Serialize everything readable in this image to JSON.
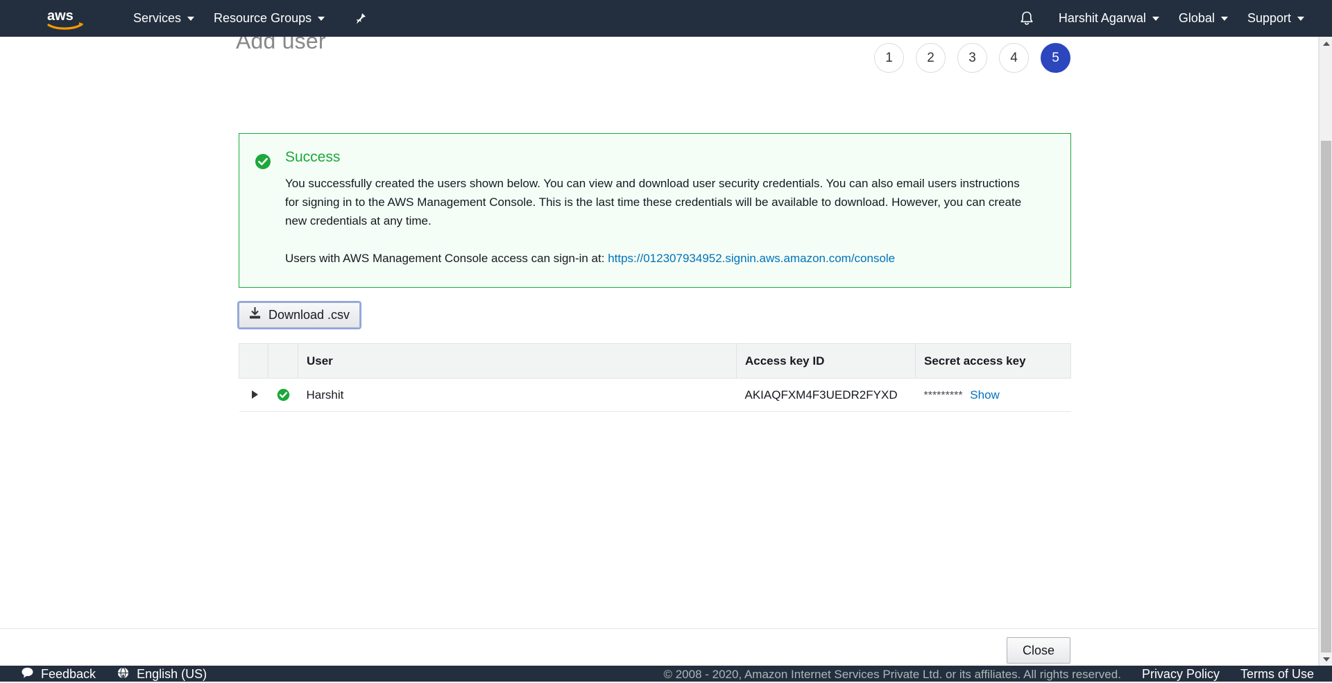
{
  "topnav": {
    "logo_alt": "aws",
    "services_label": "Services",
    "resource_groups_label": "Resource Groups",
    "pin_icon": "pin-icon",
    "bell_icon": "bell-icon",
    "account_label": "Harshit Agarwal",
    "region_label": "Global",
    "support_label": "Support"
  },
  "wizard": {
    "title": "Add user",
    "steps": [
      {
        "label": "1",
        "active": false
      },
      {
        "label": "2",
        "active": false
      },
      {
        "label": "3",
        "active": false
      },
      {
        "label": "4",
        "active": false
      },
      {
        "label": "5",
        "active": true
      }
    ],
    "active_step_color": "#2c46bd"
  },
  "alert": {
    "icon": "success-check-icon",
    "accent_color": "#1ca83a",
    "background_color": "#f4fdf6",
    "title": "Success",
    "paragraph": "You successfully created the users shown below. You can view and download user security credentials. You can also email users instructions for signing in to the AWS Management Console. This is the last time these credentials will be available to download. However, you can create new credentials at any time.",
    "signin_prefix": "Users with AWS Management Console access can sign-in at:",
    "signin_url": "https://012307934952.signin.aws.amazon.com/console",
    "link_color": "#0073bb"
  },
  "download_button": {
    "icon": "download-icon",
    "label": "Download .csv"
  },
  "table": {
    "columns": [
      "",
      "",
      "User",
      "Access key ID",
      "Secret access key"
    ],
    "rows": [
      {
        "expander_icon": "chevron-right-icon",
        "status_icon": "success-check-icon",
        "user": "Harshit",
        "access_key_id": "AKIAQFXM4F3UEDR2FYXD",
        "secret_access_key_mask": "*********",
        "secret_show_label": "Show"
      }
    ]
  },
  "actions": {
    "close_label": "Close"
  },
  "footer": {
    "feedback_icon": "feedback-bubble-icon",
    "feedback_label": "Feedback",
    "language_icon": "globe-icon",
    "language_label": "English (US)",
    "copyright": "© 2008 - 2020, Amazon Internet Services Private Ltd. or its affiliates. All rights reserved.",
    "privacy_label": "Privacy Policy",
    "terms_label": "Terms of Use"
  },
  "scrollbar": {
    "up_icon": "scroll-up-arrow-icon",
    "down_icon": "scroll-down-arrow-icon"
  }
}
